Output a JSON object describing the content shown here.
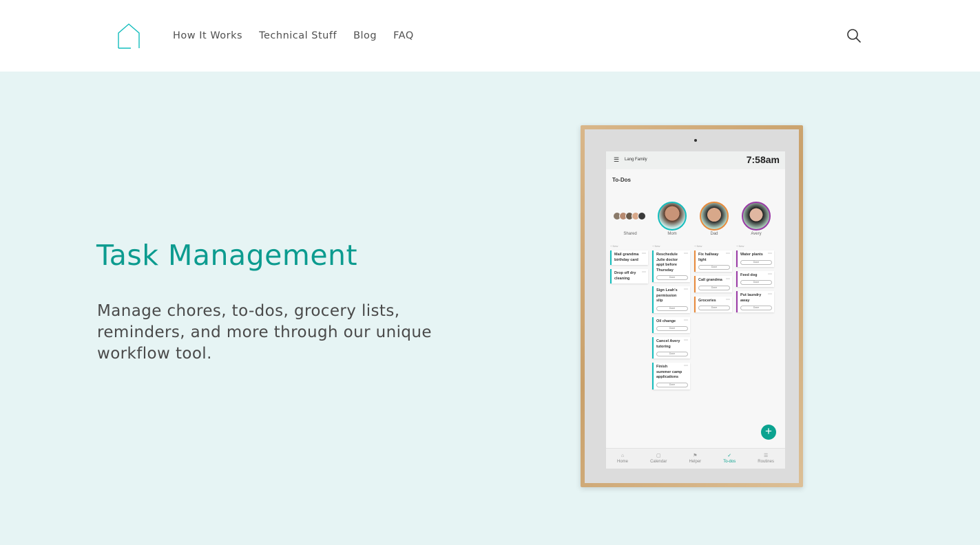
{
  "nav": {
    "logo_icon": "house-outline-icon",
    "items": [
      "How It Works",
      "Technical Stuff",
      "Blog",
      "FAQ"
    ],
    "search_icon": "search-icon"
  },
  "hero": {
    "title": "Task Management",
    "description": "Manage chores, to-dos, grocery lists, reminders, and more through our unique workflow tool."
  },
  "device": {
    "family_name": "Lang Family",
    "time": "7:58am",
    "section_title": "To-Dos",
    "people": [
      {
        "name": "Shared"
      },
      {
        "name": "Mom"
      },
      {
        "name": "Dad"
      },
      {
        "name": "Avery"
      }
    ],
    "new_label": "+ New",
    "done_label": "Done",
    "tasks": {
      "shared": [
        "Mail grandma birthday card",
        "Drop off dry cleaning"
      ],
      "mom": [
        "Reschedule Julie doctor appt before Thursday",
        "Sign Leah's permission slip",
        "Oil change",
        "Cancel Avery tutoring",
        "Finish summer camp applications"
      ],
      "dad": [
        "Fix hallway light",
        "Call grandma",
        "Groceries"
      ],
      "avery": [
        "Water plants",
        "Feed dog",
        "Put laundry away"
      ]
    },
    "bottom_tabs": [
      {
        "label": "Home",
        "icon": "home-icon"
      },
      {
        "label": "Calendar",
        "icon": "calendar-icon"
      },
      {
        "label": "Helper",
        "icon": "helper-icon"
      },
      {
        "label": "To-dos",
        "icon": "check-icon"
      },
      {
        "label": "Routines",
        "icon": "list-icon"
      }
    ],
    "fab_icon": "plus-icon"
  },
  "colors": {
    "accent": "#0c9b8f",
    "hero_bg": "#e6f4f4",
    "mom": "#14bdbd",
    "dad": "#e88a3b",
    "avery": "#9a3aa6"
  }
}
